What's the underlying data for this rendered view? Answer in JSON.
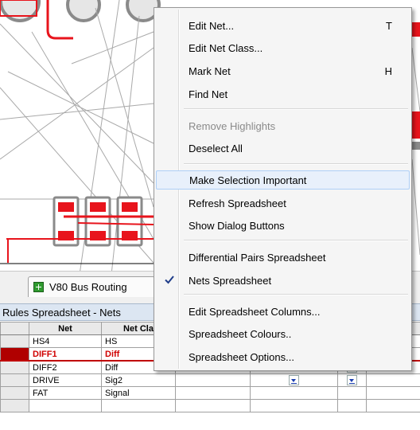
{
  "tab": {
    "label": "V80 Bus Routing"
  },
  "rules_panel": {
    "title": "Rules Spreadsheet - Nets"
  },
  "sheet": {
    "columns": [
      "Net",
      "Net Cla"
    ],
    "rows": [
      {
        "net": "HS4",
        "net_class": "HS",
        "selected": false
      },
      {
        "net": "DIFF1",
        "net_class": "Diff",
        "selected": true
      },
      {
        "net": "DIFF2",
        "net_class": "Diff",
        "selected": false
      },
      {
        "net": "DRIVE",
        "net_class": "Sig2",
        "selected": false
      },
      {
        "net": "FAT",
        "net_class": "Signal",
        "selected": false
      }
    ]
  },
  "context_menu": {
    "items": [
      {
        "label": "Edit Net...",
        "shortcut": "T"
      },
      {
        "label": "Edit Net Class..."
      },
      {
        "label": "Mark Net",
        "shortcut": "H"
      },
      {
        "label": "Find Net"
      },
      {
        "label": "Remove Highlights",
        "disabled": true
      },
      {
        "label": "Deselect All"
      },
      {
        "label": "Make Selection Important",
        "hover": true
      },
      {
        "label": "Refresh Spreadsheet"
      },
      {
        "label": "Show Dialog Buttons"
      },
      {
        "label": "Differential Pairs Spreadsheet"
      },
      {
        "label": "Nets Spreadsheet",
        "checked": true
      },
      {
        "label": "Edit Spreadsheet Columns..."
      },
      {
        "label": "Spreadsheet Colours.."
      },
      {
        "label": "Spreadsheet Options..."
      }
    ]
  },
  "colors": {
    "pcb_copper": "#e8141c",
    "pcb_pad_outline": "#888888",
    "selection_red": "#c00000",
    "menu_hover": "#e8f0fb",
    "tab_icon_green": "#2f9a2f"
  }
}
